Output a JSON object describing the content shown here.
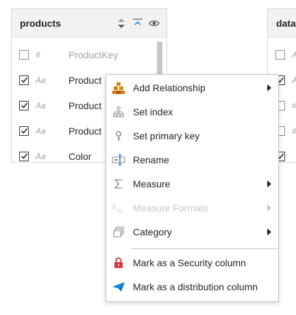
{
  "tables": {
    "products": {
      "title": "products",
      "rows": [
        {
          "type": "#",
          "name": "ProductKey",
          "checked": false
        },
        {
          "type": "Aa",
          "name": "Product",
          "checked": true
        },
        {
          "type": "Aa",
          "name": "Product",
          "checked": true
        },
        {
          "type": "Aa",
          "name": "Product",
          "checked": true
        },
        {
          "type": "Aa",
          "name": "Color",
          "checked": true
        }
      ]
    },
    "data": {
      "title": "data",
      "rows": [
        {
          "type": "A",
          "checked": false
        },
        {
          "type": "A",
          "checked": true
        },
        {
          "type": "#",
          "checked": false
        },
        {
          "type": "#",
          "checked": false
        },
        {
          "type": "",
          "checked": true
        }
      ]
    }
  },
  "menu": {
    "items": [
      {
        "label": "Add Relationship",
        "icon": "relationship-icon",
        "submenu": true,
        "disabled": false
      },
      {
        "label": "Set index",
        "icon": "hierarchy-icon",
        "submenu": false,
        "disabled": false
      },
      {
        "label": "Set primary key",
        "icon": "key-icon",
        "submenu": false,
        "disabled": false
      },
      {
        "label": "Rename",
        "icon": "rename-icon",
        "submenu": false,
        "disabled": false
      },
      {
        "label": "Measure",
        "icon": "sigma-icon",
        "submenu": true,
        "disabled": false
      },
      {
        "label": "Measure Formats",
        "icon": "format-icon",
        "submenu": true,
        "disabled": true
      },
      {
        "label": "Category",
        "icon": "category-icon",
        "submenu": true,
        "disabled": false
      },
      {
        "label": "Mark as a Security column",
        "icon": "lock-icon",
        "submenu": false,
        "disabled": false
      },
      {
        "label": "Mark as a distribution column",
        "icon": "send-icon",
        "submenu": false,
        "disabled": false
      }
    ]
  },
  "colors": {
    "accent_blue": "#0078d4",
    "lock_red": "#d13438",
    "relationship_orange": "#ca8a04",
    "disabled": "#c8c6c4"
  }
}
